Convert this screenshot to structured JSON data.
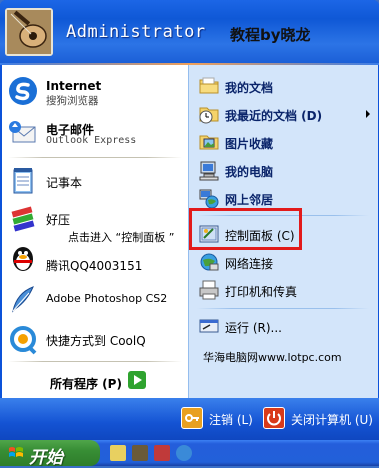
{
  "header": {
    "username": "Administrator",
    "watermark": "教程by晓龙"
  },
  "left_items": [
    {
      "title": "Internet",
      "subtitle": "搜狗浏览器"
    },
    {
      "title": "电子邮件",
      "subtitle": "Outlook Express"
    },
    {
      "title": "记事本"
    },
    {
      "title": "好压"
    },
    {
      "title": "腾讯QQ4003151"
    },
    {
      "title": "Adobe Photoshop CS2"
    },
    {
      "title": "快捷方式到 CoolQ"
    }
  ],
  "all_programs": "所有程序 (P)",
  "right_items": [
    {
      "label": "我的文档"
    },
    {
      "label": "我最近的文档 (D)"
    },
    {
      "label": "图片收藏"
    },
    {
      "label": "我的电脑"
    },
    {
      "label": "网上邻居"
    },
    {
      "label": "控制面板 (C)"
    },
    {
      "label": "网络连接"
    },
    {
      "label": "打印机和传真"
    },
    {
      "label": "运行 (R)..."
    }
  ],
  "annotation": {
    "text": "点击进入 “控制面板 ”",
    "site": "华海电脑网www.lotpc.com"
  },
  "footer": {
    "logoff": "注销 (L)",
    "shutdown": "关闭计算机 (U)"
  },
  "taskbar": {
    "start_label": "开始"
  },
  "colors": {
    "highlight_border": "#e21a1a",
    "menu_blue": "#0c52d9",
    "right_pane": "#d3e5fa"
  }
}
